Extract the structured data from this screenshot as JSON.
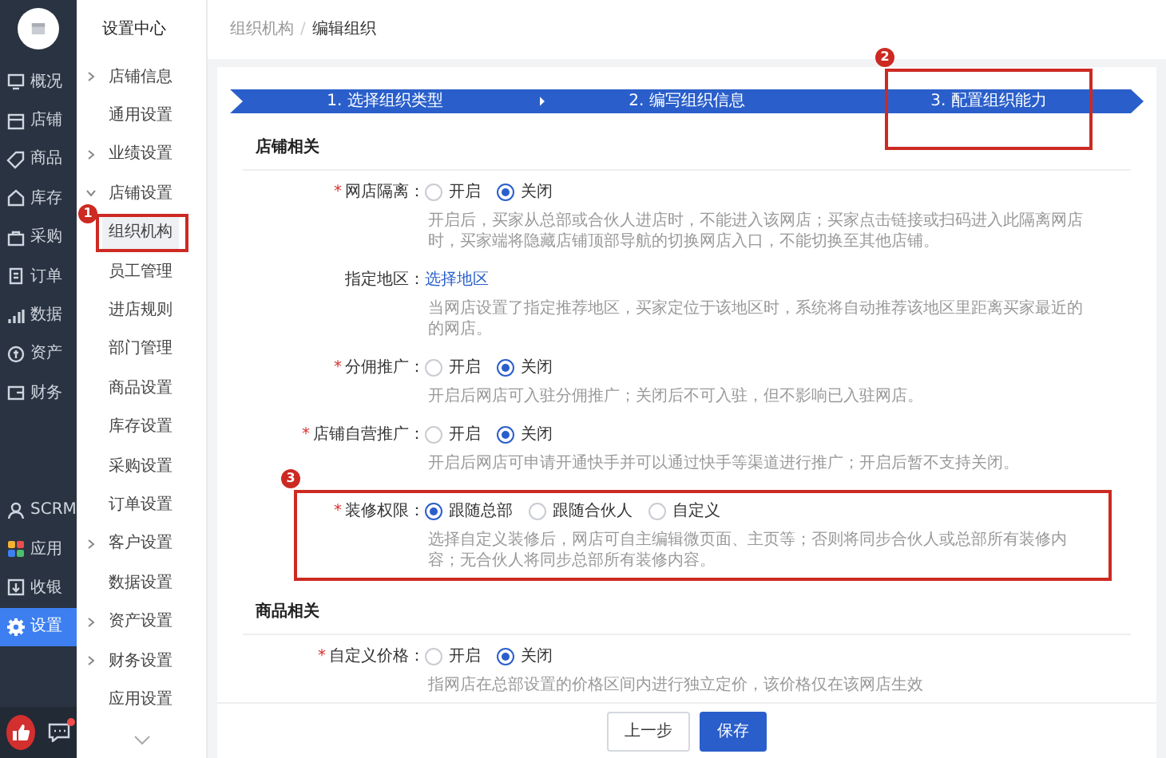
{
  "nav": [
    {
      "label": "概况",
      "selected": false
    },
    {
      "label": "店铺",
      "selected": false
    },
    {
      "label": "商品",
      "selected": false
    },
    {
      "label": "库存",
      "selected": false
    },
    {
      "label": "采购",
      "selected": false
    },
    {
      "label": "订单",
      "selected": false
    },
    {
      "label": "数据",
      "selected": false
    },
    {
      "label": "资产",
      "selected": false
    },
    {
      "label": "财务",
      "selected": false
    }
  ],
  "nav_bottom": [
    {
      "label": "SCRM",
      "selected": false
    },
    {
      "label": "应用",
      "selected": false
    },
    {
      "label": "收银",
      "selected": false
    },
    {
      "label": "设置",
      "selected": true
    }
  ],
  "settings_menu": {
    "title": "设置中心",
    "items": [
      {
        "label": "店铺信息",
        "expandable": true,
        "expanded": false,
        "selected": false
      },
      {
        "label": "通用设置",
        "expandable": false,
        "selected": false
      },
      {
        "label": "业绩设置",
        "expandable": true,
        "expanded": false,
        "selected": false
      },
      {
        "label": "店铺设置",
        "expandable": true,
        "expanded": true,
        "selected": false,
        "children": [
          {
            "label": "组织机构",
            "selected": true,
            "callout": "1"
          },
          {
            "label": "员工管理",
            "selected": false
          },
          {
            "label": "进店规则",
            "selected": false
          },
          {
            "label": "部门管理",
            "selected": false
          }
        ]
      },
      {
        "label": "商品设置",
        "expandable": false,
        "selected": false
      },
      {
        "label": "库存设置",
        "expandable": false,
        "selected": false
      },
      {
        "label": "采购设置",
        "expandable": false,
        "selected": false
      },
      {
        "label": "订单设置",
        "expandable": false,
        "selected": false
      },
      {
        "label": "客户设置",
        "expandable": true,
        "expanded": false,
        "selected": false
      },
      {
        "label": "数据设置",
        "expandable": false,
        "selected": false
      },
      {
        "label": "资产设置",
        "expandable": true,
        "expanded": false,
        "selected": false
      },
      {
        "label": "财务设置",
        "expandable": true,
        "expanded": false,
        "selected": false
      },
      {
        "label": "应用设置",
        "expandable": false,
        "selected": false
      }
    ]
  },
  "breadcrumb": [
    "组织机构",
    "编辑组织"
  ],
  "breadcrumb_separator": "/",
  "steps": [
    {
      "label": "1. 选择组织类型"
    },
    {
      "label": "2. 编写组织信息"
    },
    {
      "label": "3. 配置组织能力",
      "callout": "2"
    }
  ],
  "sections": [
    {
      "title": "店铺相关",
      "fields": [
        {
          "kind": "radio",
          "mark": "*",
          "label": "网店隔离：",
          "options": [
            {
              "label": "开启",
              "selected": false
            },
            {
              "label": "关闭",
              "selected": true
            }
          ],
          "hint": "开启后，买家从总部或合伙人进店时，不能进入该网店；买家点击链接或扫码进入此隔离网店时，买家端将隐藏店铺顶部导航的切换网店入口，不能切换至其他店铺。"
        },
        {
          "kind": "link",
          "label": "指定地区：",
          "link": "选择地区",
          "hint": "当网店设置了指定推荐地区，买家定位于该地区时，系统将自动推荐该地区里距离买家最近的的网店。"
        },
        {
          "kind": "radio",
          "mark": "*",
          "label": "分佣推广：",
          "options": [
            {
              "label": "开启",
              "selected": false
            },
            {
              "label": "关闭",
              "selected": true
            }
          ],
          "hint": "开启后网店可入驻分佣推广；关闭后不可入驻，但不影响已入驻网店。"
        },
        {
          "kind": "radio",
          "mark": "*",
          "label": "店铺自营推广：",
          "options": [
            {
              "label": "开启",
              "selected": false
            },
            {
              "label": "关闭",
              "selected": true
            }
          ],
          "hint": "开启后网店可申请开通快手并可以通过快手等渠道进行推广；开启后暂不支持关闭。"
        },
        {
          "kind": "radio",
          "mark": "*",
          "label": "装修权限：",
          "callout": "3",
          "options": [
            {
              "label": "跟随总部",
              "selected": true
            },
            {
              "label": "跟随合伙人",
              "selected": false
            },
            {
              "label": "自定义",
              "selected": false
            }
          ],
          "hint": "选择自定义装修后，网店可自主编辑微页面、主页等；否则将同步合伙人或总部所有装修内容；无合伙人将同步总部所有装修内容。"
        }
      ]
    },
    {
      "title": "商品相关",
      "fields": [
        {
          "kind": "radio",
          "mark": "*",
          "label": "自定义价格：",
          "options": [
            {
              "label": "开启",
              "selected": false
            },
            {
              "label": "关闭",
              "selected": true
            }
          ],
          "hint": "指网店在总部设置的价格区间内进行独立定价，该价格仅在该网店生效"
        }
      ]
    }
  ],
  "buttons": [
    {
      "label": "上一步",
      "kind": "secondary"
    },
    {
      "label": "保存",
      "kind": "primary"
    }
  ],
  "chat_unread": true
}
